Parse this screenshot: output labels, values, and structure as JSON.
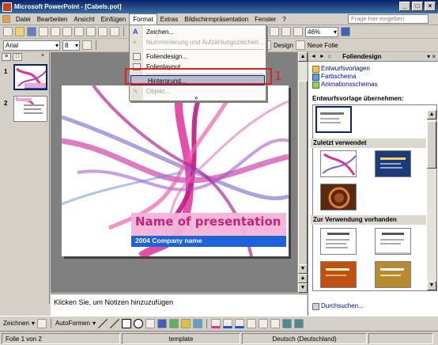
{
  "window": {
    "title": "Microsoft PowerPoint - [Cabels.pot]"
  },
  "menubar": {
    "items": [
      {
        "label": "Datei"
      },
      {
        "label": "Bearbeiten"
      },
      {
        "label": "Ansicht"
      },
      {
        "label": "Einfügen"
      },
      {
        "label": "Format"
      },
      {
        "label": "Extras"
      },
      {
        "label": "Bildschirmpräsentation"
      },
      {
        "label": "Fenster"
      },
      {
        "label": "?"
      }
    ],
    "ask_placeholder": "Frage hier eingeben"
  },
  "formatting": {
    "font": "Arial",
    "size": "8",
    "zoom": "46%",
    "design_label": "Design",
    "newslide_label": "Neue Folie"
  },
  "format_menu": {
    "items": [
      {
        "label": "Zeichen...",
        "enabled": true
      },
      {
        "label": "Nummerierung und Aufzählungszeichen...",
        "enabled": false
      },
      {
        "label": "Foliendesign...",
        "enabled": true
      },
      {
        "label": "Folienlayout...",
        "enabled": true
      },
      {
        "label": "Hintergrund...",
        "enabled": true,
        "highlighted": true
      },
      {
        "label": "Objekt...",
        "enabled": false
      }
    ],
    "expand_glyph": "»"
  },
  "callout": {
    "number": "1"
  },
  "slides_pane": {
    "thumbs": [
      {
        "num": "1"
      },
      {
        "num": "2"
      }
    ]
  },
  "slide": {
    "title": "Name of presentation",
    "subtitle": "2004 Company name"
  },
  "notes": {
    "placeholder": "Klicken Sie, um Notizen hinzuzufügen"
  },
  "task_pane": {
    "title": "Foliendesign",
    "links": [
      {
        "label": "Entwurfsvorlagen"
      },
      {
        "label": "Farbschema"
      },
      {
        "label": "Animationsschemas"
      }
    ],
    "section_apply": "Entwurfsvorlage übernehmen:",
    "group_recent": "Zuletzt verwendet",
    "group_available": "Zur Verwendung vorhanden",
    "browse_label": "Durchsuchen..."
  },
  "drawbar": {
    "zeichnen": "Zeichnen",
    "autoformen": "AutoFormen"
  },
  "status": {
    "slide": "Folie 1 von 2",
    "template": "template",
    "language": "Deutsch (Deutschland)"
  },
  "colors": {
    "title_pink": "#c0267a",
    "company_blue": "#1f62d8",
    "titlebar": "#0a246a",
    "highlight": "#b6bdd2",
    "callout_red": "#e02020"
  }
}
